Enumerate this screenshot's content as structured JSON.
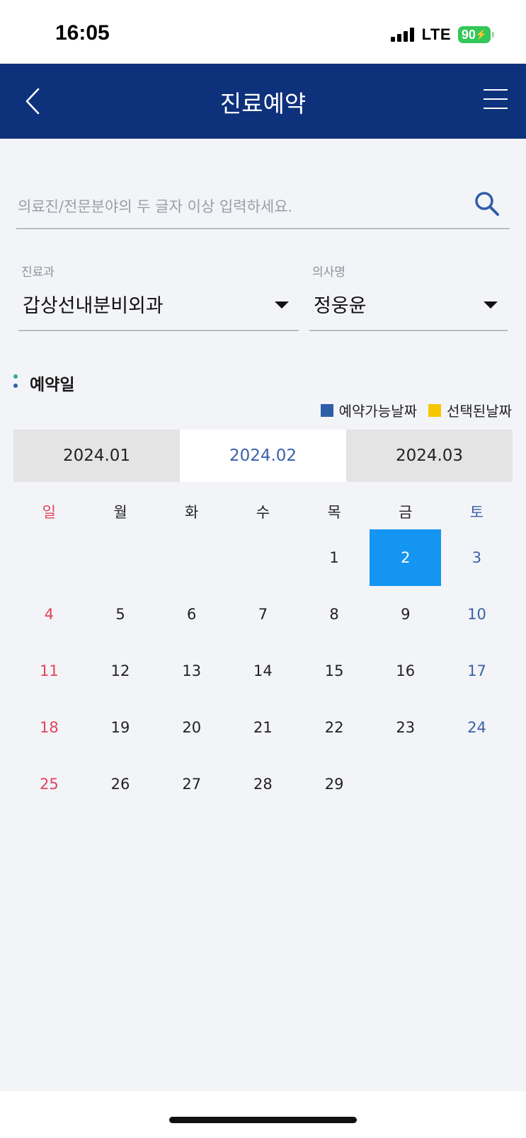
{
  "status_bar": {
    "time": "16:05",
    "network": "LTE",
    "battery": "90"
  },
  "header": {
    "title": "진료예약",
    "back_icon": "chevron-left-icon",
    "menu_icon": "hamburger-menu-icon"
  },
  "search": {
    "placeholder": "의료진/전문분야의 두 글자 이상 입력하세요.",
    "value": "",
    "icon": "search-icon"
  },
  "department": {
    "label": "진료과",
    "value": "갑상선내분비외과"
  },
  "doctor": {
    "label": "의사명",
    "value": "정웅윤"
  },
  "section": {
    "title": "예약일"
  },
  "legend": {
    "available": {
      "label": "예약가능날짜",
      "color": "#2f5ea9"
    },
    "selected": {
      "label": "선택된날짜",
      "color": "#f7c600"
    }
  },
  "months": [
    {
      "label": "2024.01",
      "active": false
    },
    {
      "label": "2024.02",
      "active": true
    },
    {
      "label": "2024.03",
      "active": false
    }
  ],
  "calendar": {
    "weekdays": [
      "일",
      "월",
      "화",
      "수",
      "목",
      "금",
      "토"
    ],
    "weeks": [
      [
        "",
        "",
        "",
        "",
        "1",
        "2",
        "3"
      ],
      [
        "4",
        "5",
        "6",
        "7",
        "8",
        "9",
        "10"
      ],
      [
        "11",
        "12",
        "13",
        "14",
        "15",
        "16",
        "17"
      ],
      [
        "18",
        "19",
        "20",
        "21",
        "22",
        "23",
        "24"
      ],
      [
        "25",
        "26",
        "27",
        "28",
        "29",
        "",
        ""
      ]
    ],
    "selected_day": "2"
  },
  "colors": {
    "header_bg": "#0e317c",
    "selected_cell": "#1495f2",
    "sunday": "#e0445d",
    "saturday": "#3a62a8"
  }
}
